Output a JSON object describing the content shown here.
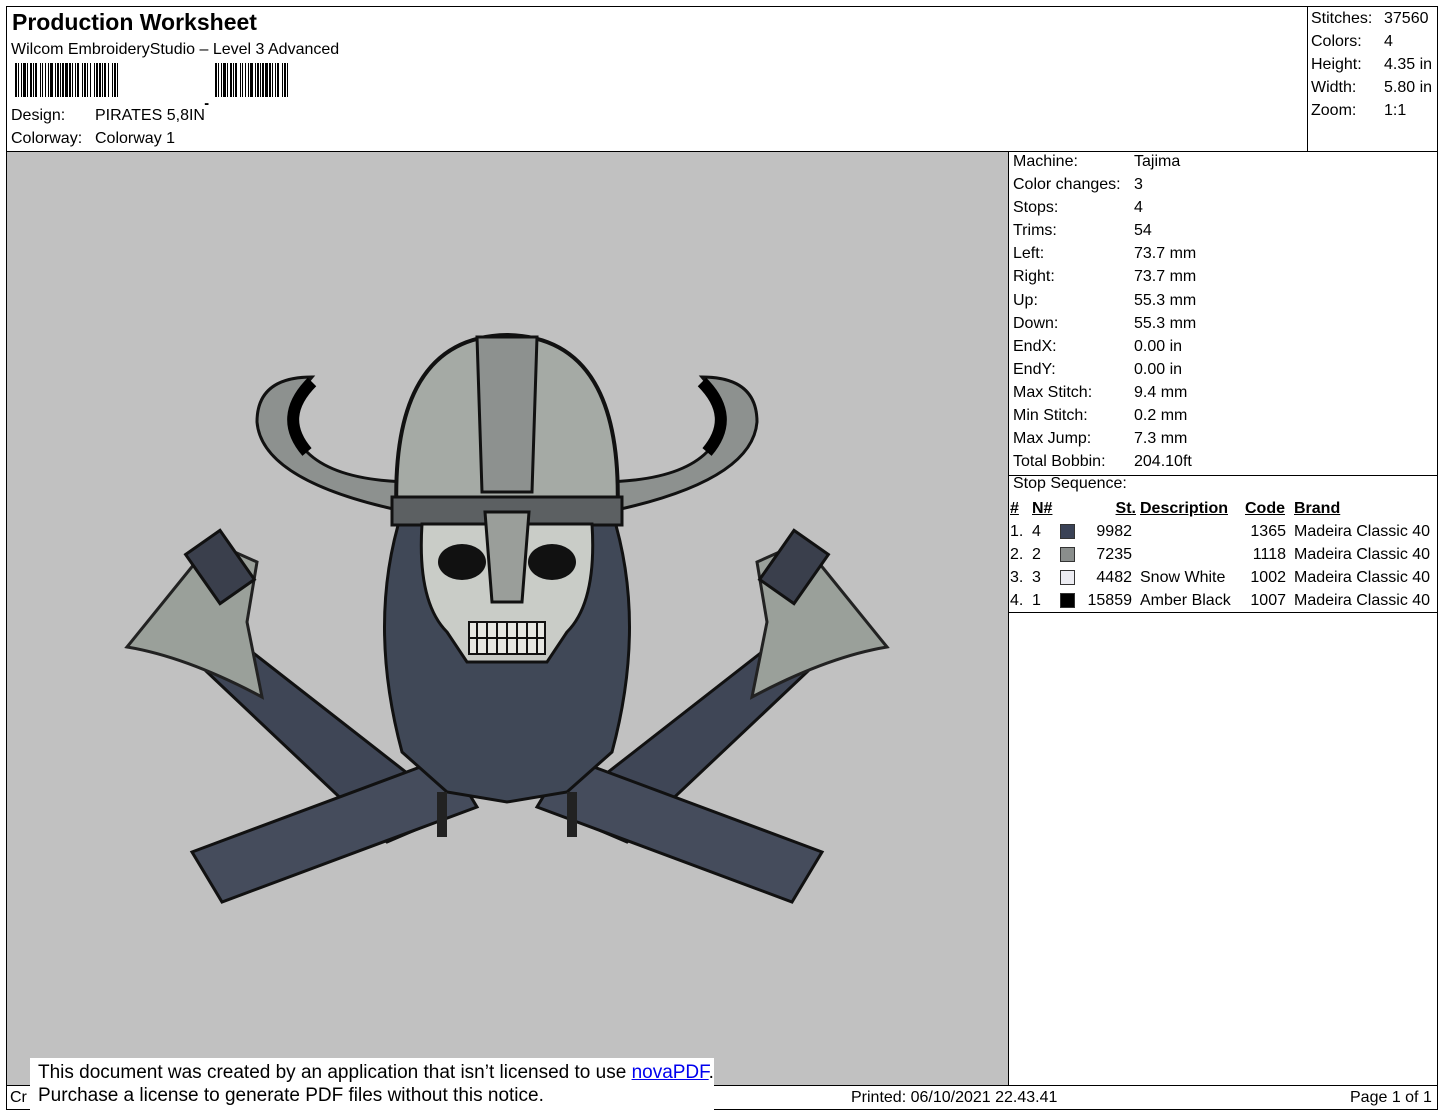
{
  "header": {
    "title": "Production Worksheet",
    "software": "Wilcom EmbroideryStudio – Level 3 Advanced",
    "barcode_text": ",",
    "design_label": "Design:",
    "design_value": "PIRATES 5,8IN",
    "colorway_label": "Colorway:",
    "colorway_value": "Colorway 1"
  },
  "stats": [
    {
      "label": "Stitches:",
      "value": "37560"
    },
    {
      "label": "Colors:",
      "value": "4"
    },
    {
      "label": "Height:",
      "value": "4.35 in"
    },
    {
      "label": "Width:",
      "value": "5.80 in"
    },
    {
      "label": "Zoom:",
      "value": "1:1"
    }
  ],
  "info": [
    {
      "label": "Machine:",
      "value": "Tajima"
    },
    {
      "label": "Color changes:",
      "value": "3"
    },
    {
      "label": "Stops:",
      "value": "4"
    },
    {
      "label": "Trims:",
      "value": "54"
    },
    {
      "label": "Left:",
      "value": "73.7 mm"
    },
    {
      "label": "Right:",
      "value": "73.7 mm"
    },
    {
      "label": "Up:",
      "value": "55.3 mm"
    },
    {
      "label": "Down:",
      "value": "55.3 mm"
    },
    {
      "label": "EndX:",
      "value": "0.00 in"
    },
    {
      "label": "EndY:",
      "value": "0.00 in"
    },
    {
      "label": "Max Stitch:",
      "value": "9.4 mm"
    },
    {
      "label": "Min Stitch:",
      "value": "0.2 mm"
    },
    {
      "label": "Max Jump:",
      "value": "7.3 mm"
    },
    {
      "label": "Total Bobbin:",
      "value": "204.10ft"
    }
  ],
  "stop_sequence": {
    "title": "Stop Sequence:",
    "headers": {
      "num": "#",
      "n": "N#",
      "st": "St.",
      "description": "Description",
      "code": "Code",
      "brand": "Brand"
    },
    "rows": [
      {
        "num": "1.",
        "n": "4",
        "color": "#3a4256",
        "st": "9982",
        "description": "",
        "code": "1365",
        "brand": "Madeira Classic 40"
      },
      {
        "num": "2.",
        "n": "2",
        "color": "#8a8e8c",
        "st": "7235",
        "description": "",
        "code": "1118",
        "brand": "Madeira Classic 40"
      },
      {
        "num": "3.",
        "n": "3",
        "color": "#ececf2",
        "st": "4482",
        "description": "Snow White",
        "code": "1002",
        "brand": "Madeira Classic 40"
      },
      {
        "num": "4.",
        "n": "1",
        "color": "#000000",
        "st": "15859",
        "description": "Amber Black",
        "code": "1007",
        "brand": "Madeira Classic 40"
      }
    ]
  },
  "footer": {
    "left_text": "Cr",
    "printed": "Printed: 06/10/2021 22.43.41",
    "page": "Page 1 of 1"
  },
  "notice": {
    "line1_prefix": "This document was created by an application that isn’t licensed to use ",
    "link": "novaPDF",
    "line1_suffix": ".",
    "line2": "Purchase a license to generate PDF files without this notice."
  }
}
